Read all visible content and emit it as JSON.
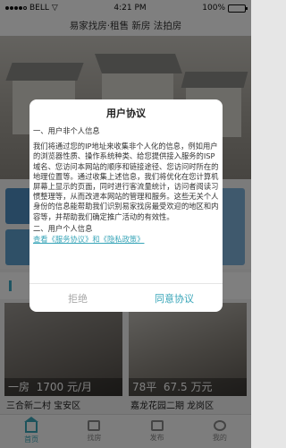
{
  "status_bar": {
    "carrier": "BELL",
    "time": "4:21 PM",
    "battery": "100%"
  },
  "header": {
    "title": "易家找房·租售 新房 法拍房"
  },
  "cards": [
    {
      "price_prefix": "一房",
      "price": "1700 元/月",
      "address": "三合新二村 宝安区"
    },
    {
      "price_prefix": "78平",
      "price": "67.5 万元",
      "address": "嘉龙花园二期 龙岗区"
    }
  ],
  "tabs": [
    {
      "label": "首页",
      "icon": "home-icon",
      "active": true
    },
    {
      "label": "找房",
      "icon": "search-house-icon",
      "active": false
    },
    {
      "label": "发布",
      "icon": "publish-icon",
      "active": false
    },
    {
      "label": "我的",
      "icon": "profile-icon",
      "active": false
    }
  ],
  "dialog": {
    "title": "用户协议",
    "section1_heading": "一、用户非个人信息",
    "section1_body": "我们将通过您的IP地址来收集非个人化的信息，例如用户的浏览器性质、操作系统种类、给您提供接入服务的ISP域名、您访问本网站的顺序和链接途径、您访问时所在的地理位置等。通过收集上述信息，我们将优化在您计算机屏幕上显示的页面，同时进行客流量统计，访问者阅读习惯整理等，从而改进本网站的管理和服务。这些无关个人身份的信息能帮助我们识别易家找房最受欢迎的地区和内容等，并帮助我们确定推广活动的有效性。",
    "section2_heading": "二、用户个人信息",
    "link_text": "查看《服务协议》和《隐私政策》",
    "reject_label": "拒绝",
    "agree_label": "同意协议"
  },
  "colors": {
    "accent": "#3aa6b9",
    "overlay": "rgba(0,0,0,0.5)"
  }
}
